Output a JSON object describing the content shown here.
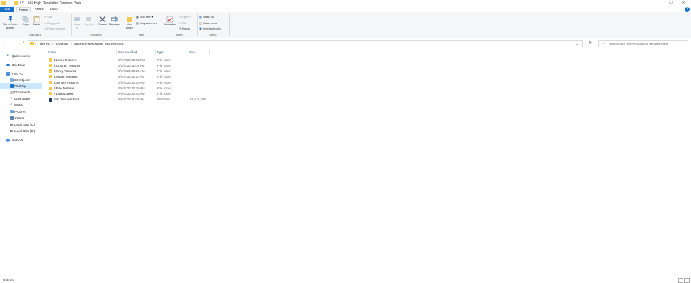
{
  "window": {
    "title": "555 High-Resolution Textures Pack",
    "title_sep": "| =",
    "minimize": "–",
    "maximize": "❐",
    "close": "✕"
  },
  "ribbon_tabs": [
    "File",
    "Home",
    "Share",
    "View"
  ],
  "ribbon": {
    "clipboard": {
      "pin_label": "Pin to Quick access",
      "copy_label": "Copy",
      "paste_label": "Paste",
      "cut_label": "Cut",
      "copy_path_label": "Copy path",
      "paste_shortcut_label": "Paste shortcut",
      "group_label": "Clipboard"
    },
    "organize": {
      "move_label": "Move to",
      "copy_to_label": "Copy to",
      "delete_label": "Delete",
      "rename_label": "Rename",
      "group_label": "Organize"
    },
    "new": {
      "new_folder_label": "New folder",
      "new_item_label": "New item",
      "easy_access_label": "Easy access",
      "group_label": "New"
    },
    "open": {
      "properties_label": "Properties",
      "open_label": "Open",
      "edit_label": "Edit",
      "history_label": "History",
      "group_label": "Open"
    },
    "select": {
      "select_all_label": "Select all",
      "select_none_label": "Select none",
      "invert_label": "Invert selection",
      "group_label": "Select"
    }
  },
  "address": {
    "crumbs": [
      "This PC",
      "Desktop",
      "555 High-Resolution Textures Pack"
    ],
    "search_placeholder": "Search 555 High-Resolution Textures Pack"
  },
  "nav": {
    "quick_access": "Quick access",
    "onedrive": "OneDrive",
    "this_pc": "This PC",
    "objects_3d": "3D Objects",
    "desktop": "Desktop",
    "documents": "Documents",
    "downloads": "Downloads",
    "music": "Music",
    "pictures": "Pictures",
    "videos": "Videos",
    "local_c": "Local Disk (C:)",
    "local_d": "Local Disk (D:)",
    "network": "Network"
  },
  "columns": {
    "name": "Name",
    "date": "Date modified",
    "type": "Type",
    "size": "Size"
  },
  "files": [
    {
      "name": "1.Lines Textures",
      "date": "9/9/2022 10:53 PM",
      "type": "File folder",
      "size": ""
    },
    {
      "name": "2.Colored Textures",
      "date": "9/9/2022 11:04 PM",
      "type": "File folder",
      "size": ""
    },
    {
      "name": "3.Grey Textures",
      "date": "9/9/2022 10:21 AM",
      "type": "File folder",
      "size": ""
    },
    {
      "name": "4.Water Textures",
      "date": "9/9/2022 10:11 AM",
      "type": "File folder",
      "size": ""
    },
    {
      "name": "5.Smoke Textures",
      "date": "9/9/2022 10:26 AM",
      "type": "File folder",
      "size": ""
    },
    {
      "name": "6.Fire Textures",
      "date": "9/9/2022 10:28 AM",
      "type": "File folder",
      "size": ""
    },
    {
      "name": "7.Landscapes",
      "date": "9/9/2022 10:30 AM",
      "type": "File folder",
      "size": ""
    },
    {
      "name": "555 Textures Pack",
      "date": "9/9/2022 11:06 AM",
      "type": "PSB File",
      "size": "15,515,298 ..."
    }
  ],
  "status": {
    "item_count": "8 items"
  },
  "colors": {
    "accent": "#1a6fc9",
    "selection": "#cce8ff",
    "folder": "#f3c750"
  }
}
